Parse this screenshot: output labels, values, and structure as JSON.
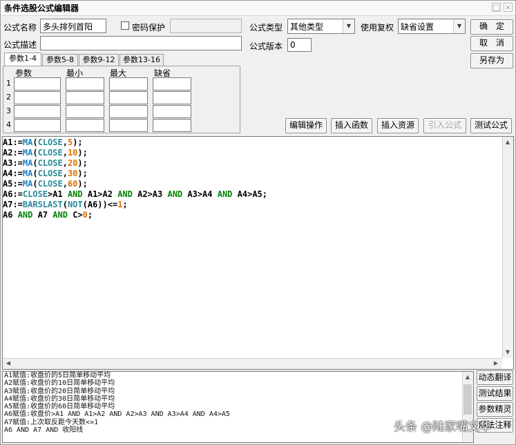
{
  "window": {
    "title": "条件选股公式编辑器"
  },
  "labels": {
    "formula_name": "公式名称",
    "password": "密码保护",
    "formula_type": "公式类型",
    "use_fuquan": "使用复权",
    "formula_desc": "公式描述",
    "formula_version": "公式版本"
  },
  "fields": {
    "formula_name_value": "多头排列首阳",
    "formula_type_value": "其他类型",
    "fuquan_value": "缺省设置",
    "version_value": "0"
  },
  "buttons": {
    "ok": "确　定",
    "cancel": "取　消",
    "save_as": "另存为",
    "edit_ops": "编辑操作",
    "insert_func": "插入函数",
    "insert_res": "插入资源",
    "import_formula": "引入公式",
    "test_formula": "测试公式",
    "dyn_translate": "动态翻译",
    "test_result": "测试结果",
    "param_wizard": "参数精灵",
    "usage_notes": "用法注释"
  },
  "tabs": [
    "参数1-4",
    "参数5-8",
    "参数9-12",
    "参数13-16"
  ],
  "param_table": {
    "headers": [
      "参数",
      "最小",
      "最大",
      "缺省"
    ],
    "rows": [
      "1",
      "2",
      "3",
      "4"
    ]
  },
  "code": {
    "l1": {
      "a": "A1:=",
      "f": "MA",
      "b": "(",
      "c": "CLOSE",
      "d": ",",
      "n": "5",
      "e": ");"
    },
    "l2": {
      "a": "A2:=",
      "f": "MA",
      "b": "(",
      "c": "CLOSE",
      "d": ",",
      "n": "10",
      "e": ");"
    },
    "l3": {
      "a": "A3:=",
      "f": "MA",
      "b": "(",
      "c": "CLOSE",
      "d": ",",
      "n": "20",
      "e": ");"
    },
    "l4": {
      "a": "A4:=",
      "f": "MA",
      "b": "(",
      "c": "CLOSE",
      "d": ",",
      "n": "30",
      "e": ");"
    },
    "l5": {
      "a": "A5:=",
      "f": "MA",
      "b": "(",
      "c": "CLOSE",
      "d": ",",
      "n": "60",
      "e": ");"
    },
    "l6": {
      "a": "A6:=",
      "c": "CLOSE",
      "t1": ">A1 ",
      "k1": "AND",
      "t2": " A1>A2 ",
      "k2": "AND",
      "t3": " A2>A3 ",
      "k3": "AND",
      "t4": " A3>A4 ",
      "k4": "AND",
      "t5": " A4>A5;"
    },
    "l7": {
      "a": "A7:=",
      "f1": "BARSLAST",
      "b": "(",
      "f2": "NOT",
      "t": "(A6))<=",
      "n": "1",
      "e": ";"
    },
    "l8": {
      "a": "A6 ",
      "k1": "AND",
      "t1": " A7 ",
      "k2": "AND",
      "t2": " C>",
      "n": "0",
      "e": ";"
    }
  },
  "output_lines": [
    "A1赋值:收盘价的5日简单移动平均",
    "A2赋值:收盘价的10日简单移动平均",
    "A3赋值:收盘价的20日简单移动平均",
    "A4赋值:收盘价的30日简单移动平均",
    "A5赋值:收盘价的60日简单移动平均",
    "A6赋值:收盘价>A1 AND A1>A2 AND A2>A3 AND A3>A4 AND A4>A5",
    "A7赋值:上次取反距今天数<=1",
    "A6 AND A7 AND 收阳线"
  ],
  "watermark": "头条 @陆家嘴文华",
  "colors": {
    "keyword": "#008000",
    "function": "#1f7fbf",
    "number": "#e07000"
  }
}
